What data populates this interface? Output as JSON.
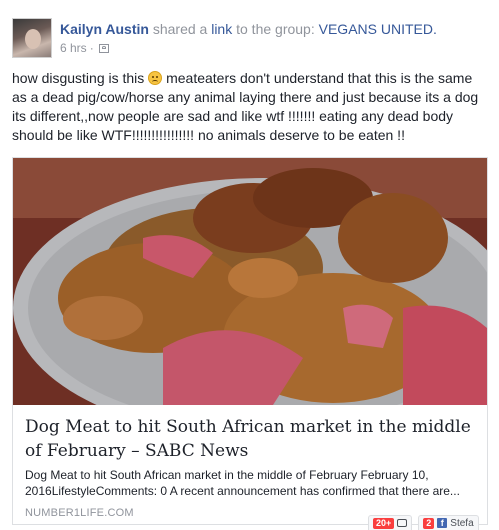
{
  "post": {
    "author": "Kailyn Austin",
    "action_prefix": "shared a",
    "action_link": "link",
    "action_suffix": "to the group:",
    "group": "VEGANS UNITED.",
    "time": "6 hrs",
    "separator": "·",
    "audience_icon": "group-audience-icon",
    "text_part1": "how disgusting is this",
    "emoji": "sad-face-emoji",
    "text_part2": "meateaters don't understand that this is the same as a dead pig/cow/horse any animal laying there and just because its a dog its different,,now people are sad and like wtf !!!!!!! eating any dead body should be like WTF!!!!!!!!!!!!!!!! no animals deserve to be eaten !!"
  },
  "card": {
    "title": "Dog Meat to hit South African market in the middle of February – SABC News",
    "description": "Dog Meat to hit South African market in the middle of February February 10, 2016LifestyleComments: 0 A recent announcement has confirmed that there are...",
    "domain": "NUMBER1LIFE.COM"
  },
  "chat_tabs": [
    {
      "badge": "20+",
      "icon": "chat-icon",
      "label": ""
    },
    {
      "badge": "2",
      "icon": "facebook-icon",
      "label": "Stefa"
    }
  ]
}
